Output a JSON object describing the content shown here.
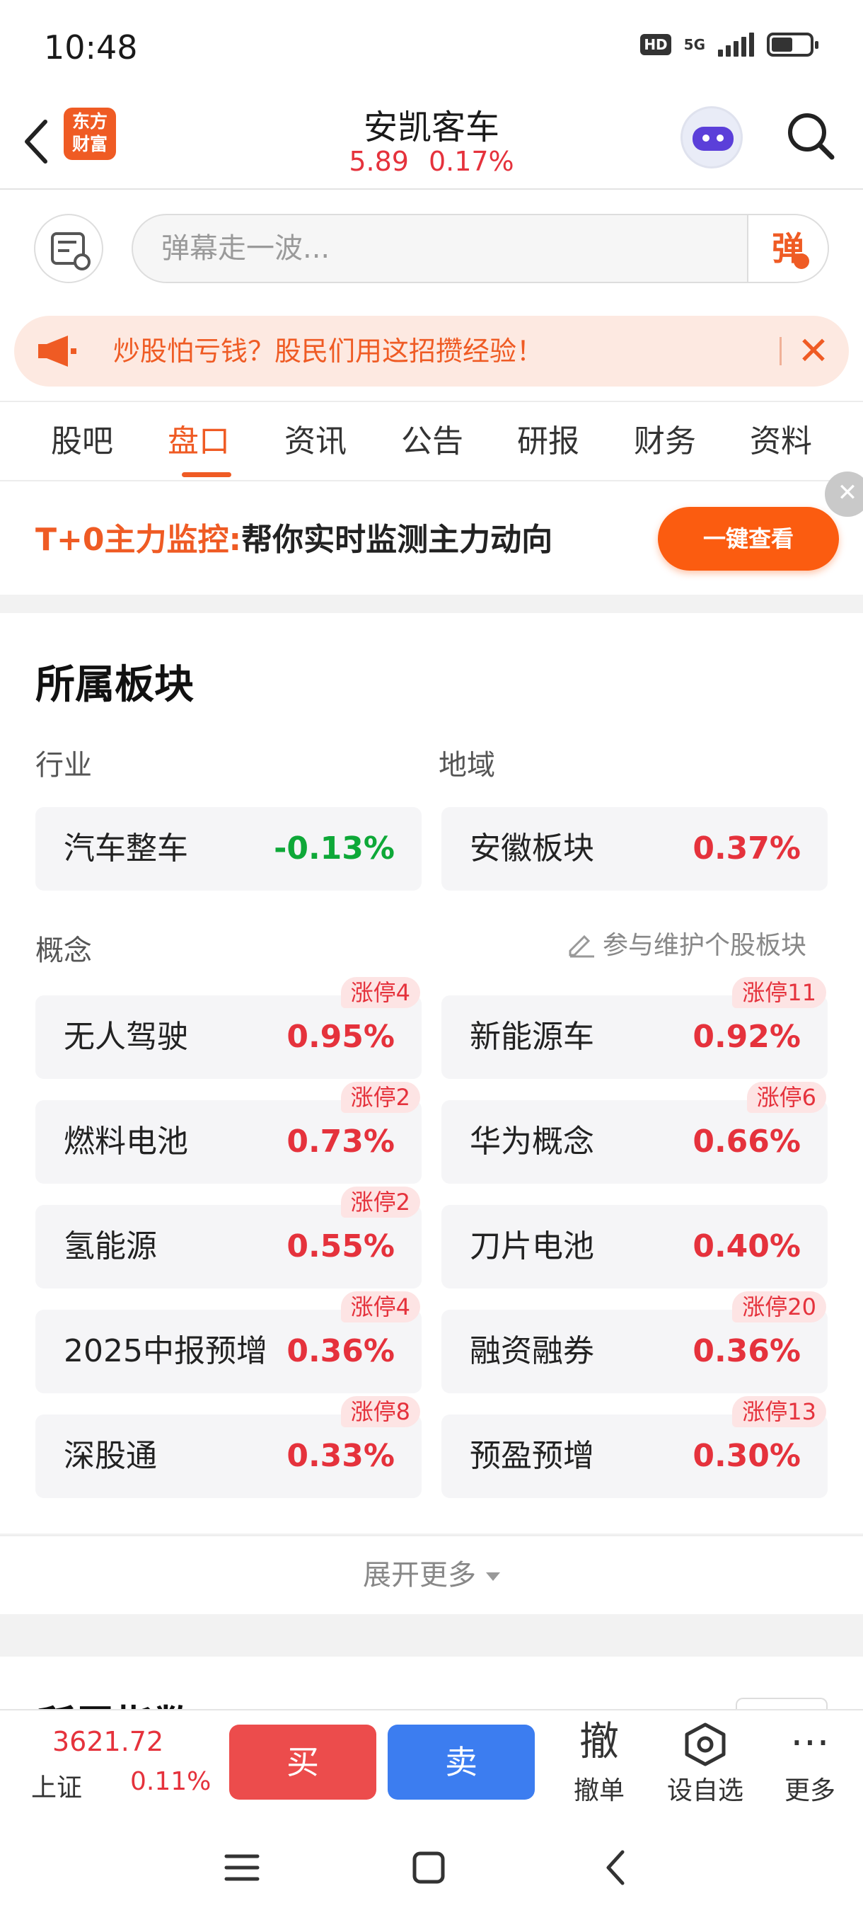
{
  "status_bar": {
    "time": "10:48",
    "hd": "HD",
    "network": "5G",
    "battery_level": 0.5
  },
  "header": {
    "logo_line1": "东方",
    "logo_line2": "财富",
    "stock_name": "安凯客车",
    "price": "5.89",
    "change_pct": "0.17%"
  },
  "danmu": {
    "placeholder": "弹幕走一波...",
    "send_label": "弹"
  },
  "notice": {
    "text": "炒股怕亏钱？股民们用这招攒经验！"
  },
  "tabs": [
    {
      "label": "股吧"
    },
    {
      "label": "盘口",
      "active": true
    },
    {
      "label": "资讯"
    },
    {
      "label": "公告"
    },
    {
      "label": "研报"
    },
    {
      "label": "财务"
    },
    {
      "label": "资料"
    }
  ],
  "ad": {
    "highlight": "T+0主力监控:",
    "text": "帮你实时监测主力动向",
    "button": "一键查看"
  },
  "sectors": {
    "title": "所属板块",
    "industry_label": "行业",
    "region_label": "地域",
    "industry": {
      "name": "汽车整车",
      "change": "-0.13%"
    },
    "region": {
      "name": "安徽板块",
      "change": "0.37%"
    },
    "concept_label": "概念",
    "maintain_label": "参与维护个股板块",
    "concepts": [
      {
        "name": "无人驾驶",
        "change": "0.95%",
        "badge": "涨停4"
      },
      {
        "name": "新能源车",
        "change": "0.92%",
        "badge": "涨停11"
      },
      {
        "name": "燃料电池",
        "change": "0.73%",
        "badge": "涨停2"
      },
      {
        "name": "华为概念",
        "change": "0.66%",
        "badge": "涨停6"
      },
      {
        "name": "氢能源",
        "change": "0.55%",
        "badge": "涨停2"
      },
      {
        "name": "刀片电池",
        "change": "0.40%",
        "badge": ""
      },
      {
        "name": "2025中报预增",
        "change": "0.36%",
        "badge": "涨停4"
      },
      {
        "name": "融资融券",
        "change": "0.36%",
        "badge": "涨停20"
      },
      {
        "name": "深股通",
        "change": "0.33%",
        "badge": "涨停8"
      },
      {
        "name": "预盈预增",
        "change": "0.30%",
        "badge": "涨停13"
      }
    ],
    "expand_label": "展开更多"
  },
  "next_section": {
    "title": "所属指数"
  },
  "bottom_bar": {
    "index_value": "3621.72",
    "index_name": "上证",
    "index_change": "0.11%",
    "buy": "买",
    "sell": "卖",
    "cancel_icon_text": "撤",
    "cancel_label": "撤单",
    "watch_label": "设自选",
    "more_label": "更多"
  },
  "colors": {
    "accent": "#ef5b24",
    "up": "#e5323c",
    "down": "#0ea838",
    "sell": "#3c7df0"
  }
}
